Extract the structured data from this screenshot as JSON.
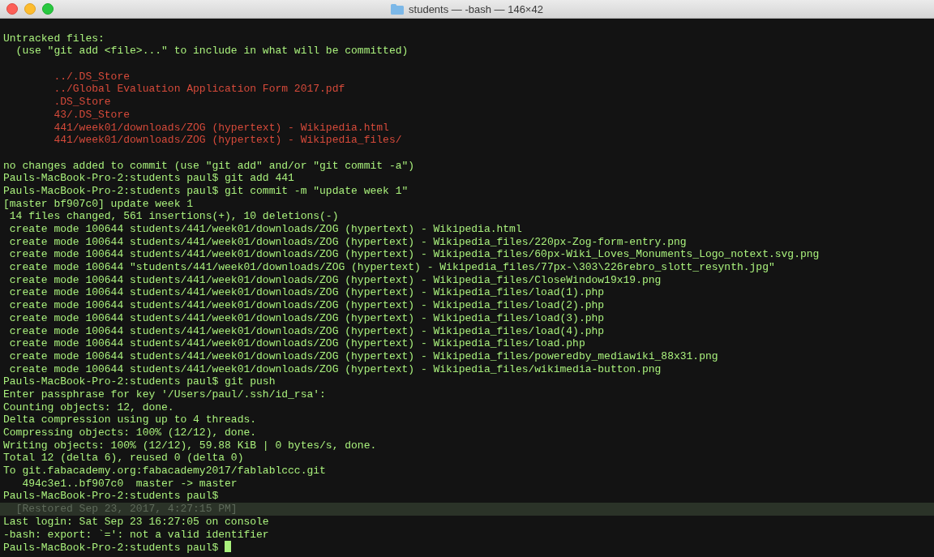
{
  "window": {
    "title": "students — -bash — 146×42"
  },
  "lines": [
    {
      "kind": "blank"
    },
    {
      "kind": "output",
      "text": "Untracked files:"
    },
    {
      "kind": "output",
      "text": "  (use \"git add <file>...\" to include in what will be committed)"
    },
    {
      "kind": "blank"
    },
    {
      "kind": "untracked",
      "text": "        ../.DS_Store"
    },
    {
      "kind": "untracked",
      "text": "        ../Global Evaluation Application Form 2017.pdf"
    },
    {
      "kind": "untracked",
      "text": "        .DS_Store"
    },
    {
      "kind": "untracked",
      "text": "        43/.DS_Store"
    },
    {
      "kind": "untracked",
      "text": "        441/week01/downloads/ZOG (hypertext) - Wikipedia.html"
    },
    {
      "kind": "untracked",
      "text": "        441/week01/downloads/ZOG (hypertext) - Wikipedia_files/"
    },
    {
      "kind": "blank"
    },
    {
      "kind": "output",
      "text": "no changes added to commit (use \"git add\" and/or \"git commit -a\")"
    },
    {
      "kind": "output",
      "text": "Pauls-MacBook-Pro-2:students paul$ git add 441"
    },
    {
      "kind": "output",
      "text": "Pauls-MacBook-Pro-2:students paul$ git commit -m \"update week 1\""
    },
    {
      "kind": "output",
      "text": "[master bf907c0] update week 1"
    },
    {
      "kind": "output",
      "text": " 14 files changed, 561 insertions(+), 10 deletions(-)"
    },
    {
      "kind": "output",
      "text": " create mode 100644 students/441/week01/downloads/ZOG (hypertext) - Wikipedia.html"
    },
    {
      "kind": "output",
      "text": " create mode 100644 students/441/week01/downloads/ZOG (hypertext) - Wikipedia_files/220px-Zog-form-entry.png"
    },
    {
      "kind": "output",
      "text": " create mode 100644 students/441/week01/downloads/ZOG (hypertext) - Wikipedia_files/60px-Wiki_Loves_Monuments_Logo_notext.svg.png"
    },
    {
      "kind": "output",
      "text": " create mode 100644 \"students/441/week01/downloads/ZOG (hypertext) - Wikipedia_files/77px-\\303\\226rebro_slott_resynth.jpg\""
    },
    {
      "kind": "output",
      "text": " create mode 100644 students/441/week01/downloads/ZOG (hypertext) - Wikipedia_files/CloseWindow19x19.png"
    },
    {
      "kind": "output",
      "text": " create mode 100644 students/441/week01/downloads/ZOG (hypertext) - Wikipedia_files/load(1).php"
    },
    {
      "kind": "output",
      "text": " create mode 100644 students/441/week01/downloads/ZOG (hypertext) - Wikipedia_files/load(2).php"
    },
    {
      "kind": "output",
      "text": " create mode 100644 students/441/week01/downloads/ZOG (hypertext) - Wikipedia_files/load(3).php"
    },
    {
      "kind": "output",
      "text": " create mode 100644 students/441/week01/downloads/ZOG (hypertext) - Wikipedia_files/load(4).php"
    },
    {
      "kind": "output",
      "text": " create mode 100644 students/441/week01/downloads/ZOG (hypertext) - Wikipedia_files/load.php"
    },
    {
      "kind": "output",
      "text": " create mode 100644 students/441/week01/downloads/ZOG (hypertext) - Wikipedia_files/poweredby_mediawiki_88x31.png"
    },
    {
      "kind": "output",
      "text": " create mode 100644 students/441/week01/downloads/ZOG (hypertext) - Wikipedia_files/wikimedia-button.png"
    },
    {
      "kind": "output",
      "text": "Pauls-MacBook-Pro-2:students paul$ git push"
    },
    {
      "kind": "output",
      "text": "Enter passphrase for key '/Users/paul/.ssh/id_rsa':"
    },
    {
      "kind": "output",
      "text": "Counting objects: 12, done."
    },
    {
      "kind": "output",
      "text": "Delta compression using up to 4 threads."
    },
    {
      "kind": "output",
      "text": "Compressing objects: 100% (12/12), done."
    },
    {
      "kind": "output",
      "text": "Writing objects: 100% (12/12), 59.88 KiB | 0 bytes/s, done."
    },
    {
      "kind": "output",
      "text": "Total 12 (delta 6), reused 0 (delta 0)"
    },
    {
      "kind": "output",
      "text": "To git.fabacademy.org:fabacademy2017/fablablccc.git"
    },
    {
      "kind": "output",
      "text": "   494c3e1..bf907c0  master -> master"
    },
    {
      "kind": "output",
      "text": "Pauls-MacBook-Pro-2:students paul$"
    },
    {
      "kind": "restored",
      "text": "  [Restored Sep 23, 2017, 4:27:15 PM]"
    },
    {
      "kind": "output",
      "text": "Last login: Sat Sep 23 16:27:05 on console"
    },
    {
      "kind": "output",
      "text": "-bash: export: `=': not a valid identifier"
    },
    {
      "kind": "prompt",
      "text": "Pauls-MacBook-Pro-2:students paul$ "
    }
  ]
}
